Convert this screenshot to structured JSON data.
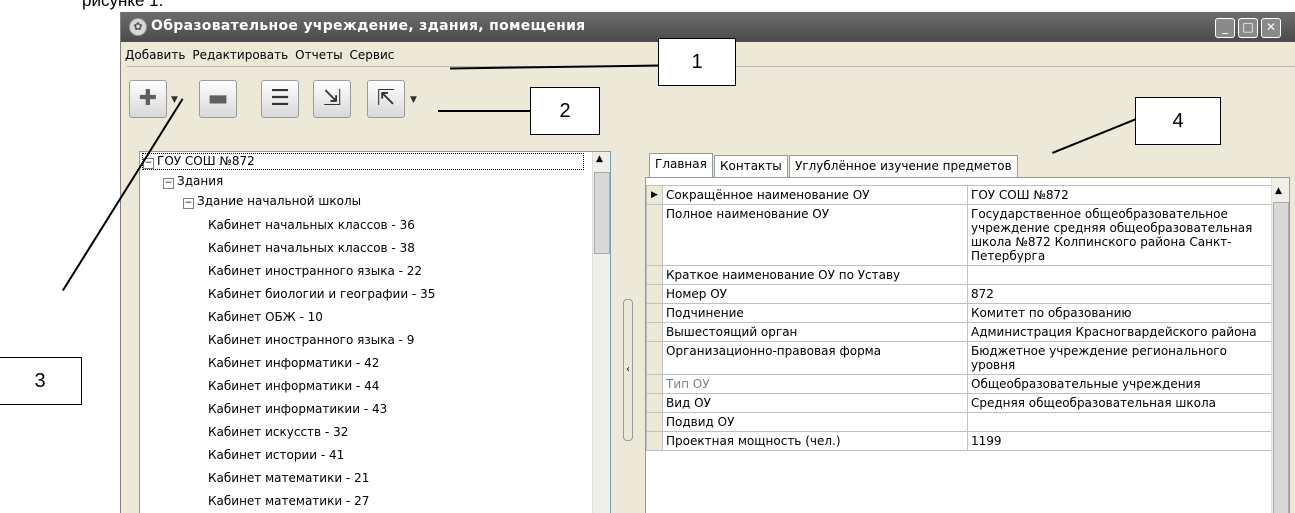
{
  "cut_text": "рисунке 1.",
  "window": {
    "title": "Образовательное учреждение, здания, помещения"
  },
  "menu": [
    "Добавить",
    "Редактировать",
    "Отчеты",
    "Сервис"
  ],
  "toolbar": {
    "add_icon": "add-doc-icon",
    "remove_icon": "remove-doc-icon",
    "report_icon": "report-icon",
    "import_icon": "import-icon",
    "export_icon": "export-icon"
  },
  "callouts": [
    "1",
    "2",
    "3",
    "4"
  ],
  "tree": {
    "root": "ГОУ СОШ №872",
    "buildings_label": "Здания",
    "building": "Здание начальной школы",
    "rooms": [
      "Кабинет начальных классов - 36",
      "Кабинет начальных классов - 38",
      "Кабинет иностранного языка - 22",
      "Кабинет  биологии и географии - 35",
      "Кабинет ОБЖ - 10",
      "Кабинет иностранного языка - 9",
      "Кабинет информатики - 42",
      "Кабинет информатики - 44",
      "Кабинет информатикии - 43",
      "Кабинет искусств - 32",
      "Кабинет истории - 41",
      "Кабинет математики - 21",
      "Кабинет математики - 27"
    ]
  },
  "tabs": [
    "Главная",
    "Контакты",
    "Углублённое изучение предметов"
  ],
  "properties": [
    {
      "name": "Сокращённое наименование ОУ",
      "value": "ГОУ СОШ №872"
    },
    {
      "name": "Полное наименование ОУ",
      "value": "Государственное общеобразовательное учреждение средняя общеобразовательная школа №872  Колпинского района Санкт-Петербурга"
    },
    {
      "name": "Краткое наименование ОУ по Уставу",
      "value": ""
    },
    {
      "name": "Номер ОУ",
      "value": "872"
    },
    {
      "name": "Подчинение",
      "value": "Комитет по образованию"
    },
    {
      "name": "Вышестоящий орган",
      "value": "Администрация Красногвардейского района"
    },
    {
      "name": "Организационно-правовая форма",
      "value": "Бюджетное учреждение регионального уровня"
    },
    {
      "name": "Тип ОУ",
      "value": "Общеобразовательные учреждения"
    },
    {
      "name": "Вид ОУ",
      "value": "Средняя общеобразовательная школа"
    },
    {
      "name": "Подвид ОУ",
      "value": ""
    },
    {
      "name": "Проектная мощность (чел.)",
      "value": "1199"
    }
  ],
  "colors": {
    "titlebar": "#5a5a5a",
    "window_bg": "#ece9d8"
  }
}
